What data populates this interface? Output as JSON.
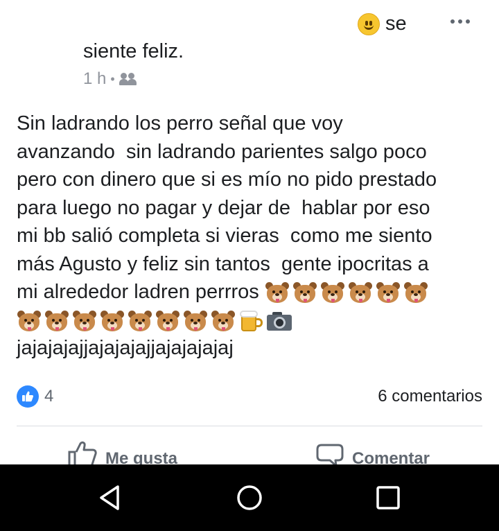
{
  "header": {
    "feeling_word": "se",
    "feeling_continuation": "siente feliz.",
    "time": "1 h",
    "separator": "•",
    "icons": {
      "feeling": "smiley-icon",
      "more": "more-options-icon",
      "audience": "friends-icon"
    }
  },
  "post": {
    "text": "Sin ladrando los perro señal que voy\navanzando  sin ladrando parientes salgo poco\npero con dinero que si es mío no pido prestado\npara luego no pagar y dejar de  hablar por eso\nmi bb salió completa si vieras  como me siento\nmás Agusto y feliz sin tantos  gente ipocritas a\nmi alrededor ladren perrros ",
    "emoji_line1_count": 6,
    "emoji_line2_dogs": 8,
    "emoji_line2_extras": [
      "beer-mug-emoji",
      "camera-emoji"
    ],
    "laugh": "jajajajajjajajajajjajajajajaj"
  },
  "footer": {
    "likes_count": "4",
    "comments_count": "6 comentarios",
    "like_label": "Me gusta",
    "comment_label": "Comentar"
  },
  "colors": {
    "like_blue": "#2d88ff",
    "text": "#1c1e21",
    "meta_gray": "#90949c",
    "action_gray": "#606770",
    "navbar": "#000000"
  }
}
